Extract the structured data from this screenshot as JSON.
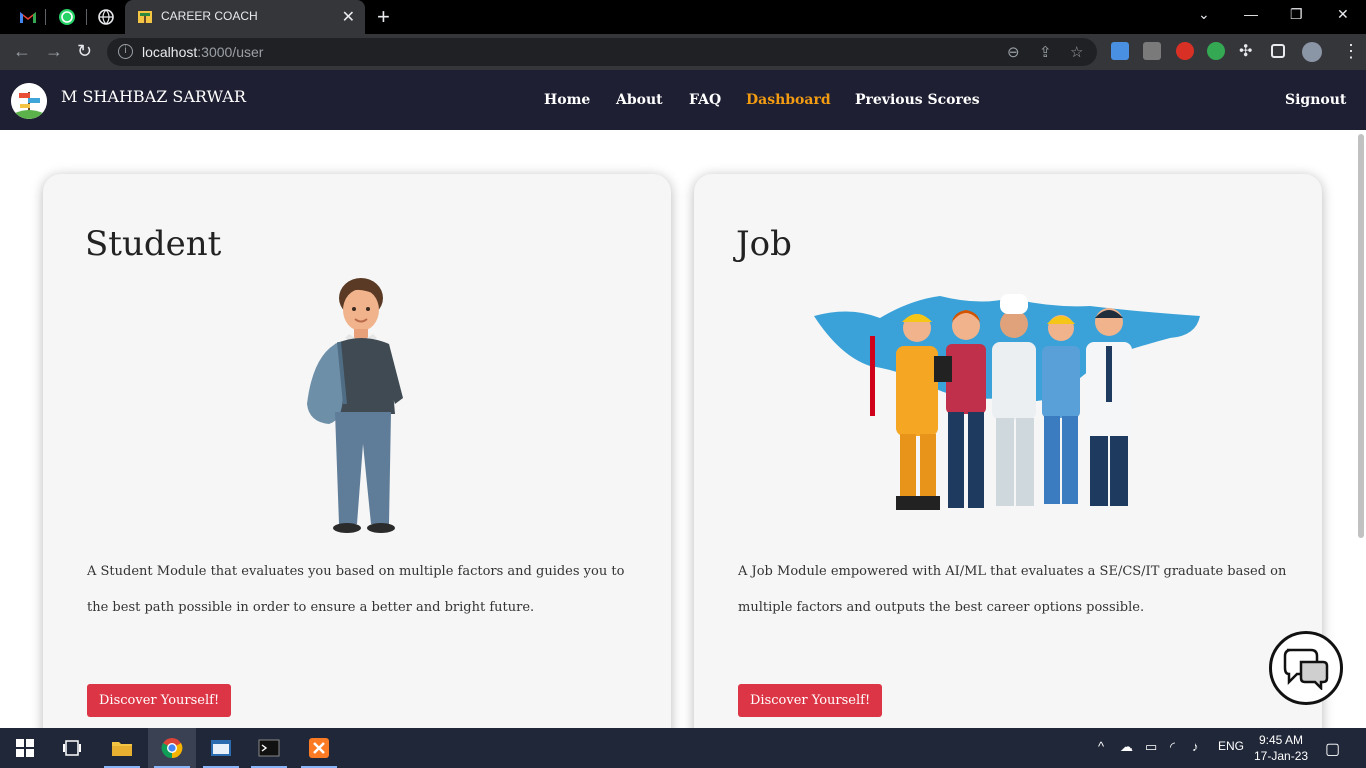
{
  "browser": {
    "active_tab_title": "CAREER COACH",
    "url_host": "localhost",
    "url_path": ":3000/user"
  },
  "navbar": {
    "brand": "M SHAHBAZ SARWAR",
    "links": [
      "Home",
      "About",
      "FAQ",
      "Dashboard",
      "Previous Scores"
    ],
    "active_link": "Dashboard",
    "signout": "Signout"
  },
  "cards": [
    {
      "title": "Student",
      "description": "A Student Module that evaluates you based on multiple factors and guides you to the best path possible in order to ensure a better and bright future.",
      "button": "Discover Yourself!"
    },
    {
      "title": "Job",
      "description": "A Job Module empowered with AI/ML that evaluates a SE/CS/IT graduate based on multiple factors and outputs the best career options possible.",
      "button": "Discover Yourself!"
    }
  ],
  "taskbar": {
    "language": "ENG",
    "time": "9:45 AM",
    "date": "17-Jan-23"
  },
  "colors": {
    "navbar_bg": "#1e1f32",
    "active_link": "#f39c12",
    "button_bg": "#dc3545",
    "card_bg": "#f6f6f6"
  },
  "icons": [
    "gmail-icon",
    "whatsapp-icon",
    "globe-icon",
    "chat-bubble-icon",
    "windows-start-icon",
    "chrome-icon"
  ]
}
